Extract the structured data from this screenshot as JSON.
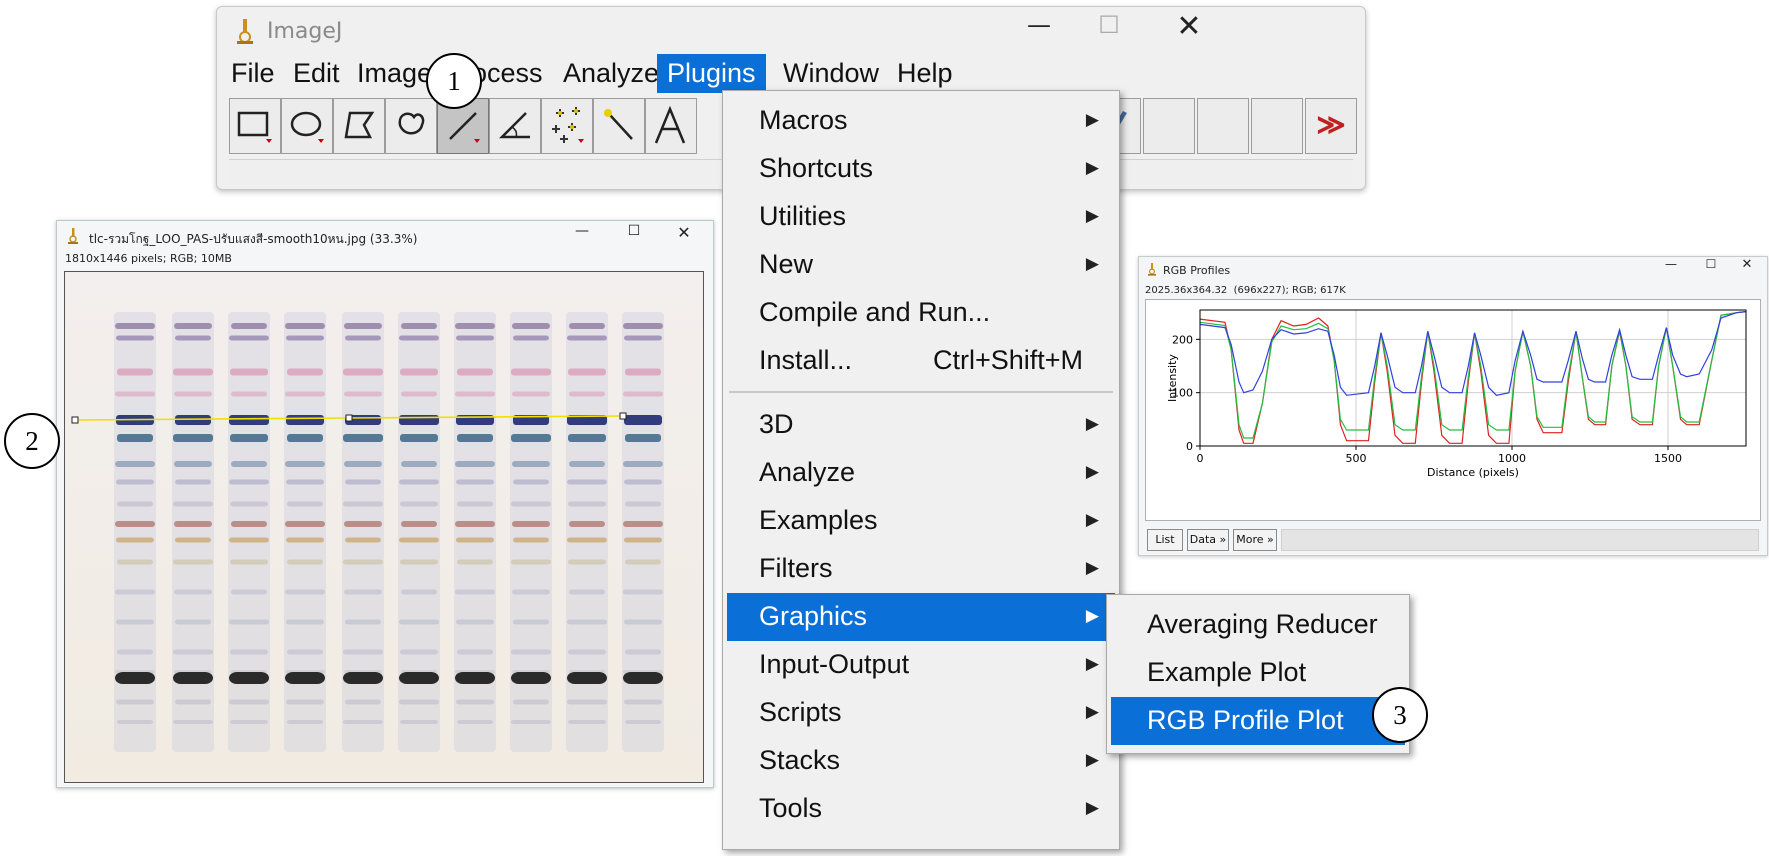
{
  "imagej": {
    "title": "ImageJ",
    "menus": [
      "File",
      "Edit",
      "Image",
      "Process",
      "Analyze",
      "Plugins",
      "Window",
      "Help"
    ],
    "more_tools": "≫"
  },
  "tlc_window": {
    "title": "tlc-รวมโกฐ_LOO_PAS-ปรับแสงสี-smooth10หน.jpg (33.3%)",
    "info": "1810x1446 pixels; RGB; 10MB"
  },
  "rgb_window": {
    "title": "RGB Profiles",
    "info": "2025.36x364.32  (696x227); RGB; 617K",
    "buttons": [
      "List",
      "Data »",
      "More »"
    ]
  },
  "plugins_menu": {
    "items": [
      {
        "label": "Macros",
        "sub": true
      },
      {
        "label": "Shortcuts",
        "sub": true
      },
      {
        "label": "Utilities",
        "sub": true
      },
      {
        "label": "New",
        "sub": true
      },
      {
        "label": "Compile and Run...",
        "sub": false
      },
      {
        "label": "Install...",
        "shortcut": "Ctrl+Shift+M",
        "sub": false
      },
      {
        "label": "3D",
        "sub": true
      },
      {
        "label": "Analyze",
        "sub": true
      },
      {
        "label": "Examples",
        "sub": true
      },
      {
        "label": "Filters",
        "sub": true
      },
      {
        "label": "Graphics",
        "sub": true,
        "highlighted": true
      },
      {
        "label": "Input-Output",
        "sub": true
      },
      {
        "label": "Scripts",
        "sub": true
      },
      {
        "label": "Stacks",
        "sub": true
      },
      {
        "label": "Tools",
        "sub": true
      }
    ]
  },
  "graphics_menu": {
    "items": [
      {
        "label": "Averaging Reducer"
      },
      {
        "label": "Example Plot"
      },
      {
        "label": "RGB Profile Plot",
        "highlighted": true
      }
    ]
  },
  "callouts": [
    "1",
    "2",
    "3"
  ],
  "chart_data": {
    "type": "line",
    "xlabel": "Distance (pixels)",
    "ylabel": "Intensity",
    "xlim": [
      0,
      1750
    ],
    "ylim": [
      0,
      255
    ],
    "xticks": [
      0,
      500,
      1000,
      1500
    ],
    "yticks": [
      0,
      100,
      200
    ],
    "series": [
      {
        "color": "#e02020",
        "points": [
          [
            0,
            238
          ],
          [
            80,
            232
          ],
          [
            100,
            180
          ],
          [
            125,
            30
          ],
          [
            140,
            5
          ],
          [
            170,
            5
          ],
          [
            200,
            80
          ],
          [
            230,
            200
          ],
          [
            260,
            235
          ],
          [
            300,
            225
          ],
          [
            340,
            228
          ],
          [
            380,
            240
          ],
          [
            410,
            225
          ],
          [
            430,
            160
          ],
          [
            450,
            40
          ],
          [
            470,
            10
          ],
          [
            540,
            10
          ],
          [
            560,
            120
          ],
          [
            580,
            212
          ],
          [
            600,
            140
          ],
          [
            625,
            20
          ],
          [
            650,
            5
          ],
          [
            690,
            5
          ],
          [
            710,
            120
          ],
          [
            730,
            215
          ],
          [
            750,
            140
          ],
          [
            775,
            20
          ],
          [
            800,
            5
          ],
          [
            840,
            5
          ],
          [
            860,
            120
          ],
          [
            880,
            212
          ],
          [
            900,
            140
          ],
          [
            925,
            20
          ],
          [
            950,
            5
          ],
          [
            990,
            5
          ],
          [
            1010,
            140
          ],
          [
            1035,
            215
          ],
          [
            1060,
            150
          ],
          [
            1080,
            50
          ],
          [
            1100,
            25
          ],
          [
            1160,
            25
          ],
          [
            1180,
            120
          ],
          [
            1205,
            215
          ],
          [
            1225,
            130
          ],
          [
            1245,
            50
          ],
          [
            1265,
            40
          ],
          [
            1300,
            40
          ],
          [
            1320,
            150
          ],
          [
            1345,
            215
          ],
          [
            1365,
            150
          ],
          [
            1385,
            50
          ],
          [
            1410,
            40
          ],
          [
            1450,
            40
          ],
          [
            1470,
            150
          ],
          [
            1495,
            222
          ],
          [
            1515,
            150
          ],
          [
            1540,
            50
          ],
          [
            1560,
            40
          ],
          [
            1600,
            40
          ],
          [
            1640,
            160
          ],
          [
            1670,
            245
          ],
          [
            1720,
            250
          ],
          [
            1750,
            252
          ]
        ]
      },
      {
        "color": "#20c040",
        "points": [
          [
            0,
            232
          ],
          [
            80,
            226
          ],
          [
            100,
            180
          ],
          [
            125,
            40
          ],
          [
            140,
            15
          ],
          [
            170,
            15
          ],
          [
            200,
            80
          ],
          [
            230,
            195
          ],
          [
            260,
            225
          ],
          [
            300,
            218
          ],
          [
            340,
            220
          ],
          [
            380,
            230
          ],
          [
            410,
            220
          ],
          [
            430,
            160
          ],
          [
            450,
            50
          ],
          [
            470,
            30
          ],
          [
            540,
            30
          ],
          [
            560,
            130
          ],
          [
            580,
            212
          ],
          [
            600,
            150
          ],
          [
            625,
            40
          ],
          [
            650,
            30
          ],
          [
            690,
            30
          ],
          [
            710,
            130
          ],
          [
            730,
            215
          ],
          [
            750,
            150
          ],
          [
            775,
            40
          ],
          [
            800,
            30
          ],
          [
            840,
            30
          ],
          [
            860,
            130
          ],
          [
            880,
            212
          ],
          [
            900,
            150
          ],
          [
            925,
            40
          ],
          [
            950,
            30
          ],
          [
            990,
            30
          ],
          [
            1010,
            140
          ],
          [
            1035,
            215
          ],
          [
            1060,
            150
          ],
          [
            1080,
            55
          ],
          [
            1100,
            35
          ],
          [
            1160,
            35
          ],
          [
            1180,
            130
          ],
          [
            1205,
            215
          ],
          [
            1225,
            130
          ],
          [
            1245,
            55
          ],
          [
            1265,
            45
          ],
          [
            1300,
            45
          ],
          [
            1320,
            150
          ],
          [
            1345,
            218
          ],
          [
            1365,
            150
          ],
          [
            1385,
            55
          ],
          [
            1410,
            45
          ],
          [
            1450,
            45
          ],
          [
            1470,
            150
          ],
          [
            1495,
            222
          ],
          [
            1515,
            150
          ],
          [
            1540,
            55
          ],
          [
            1560,
            45
          ],
          [
            1600,
            45
          ],
          [
            1640,
            160
          ],
          [
            1670,
            245
          ],
          [
            1720,
            250
          ],
          [
            1750,
            252
          ]
        ]
      },
      {
        "color": "#3040e0",
        "points": [
          [
            0,
            228
          ],
          [
            80,
            222
          ],
          [
            100,
            190
          ],
          [
            125,
            120
          ],
          [
            140,
            100
          ],
          [
            170,
            105
          ],
          [
            200,
            140
          ],
          [
            230,
            200
          ],
          [
            260,
            218
          ],
          [
            300,
            210
          ],
          [
            340,
            212
          ],
          [
            380,
            220
          ],
          [
            410,
            215
          ],
          [
            430,
            170
          ],
          [
            450,
            110
          ],
          [
            470,
            95
          ],
          [
            540,
            100
          ],
          [
            560,
            150
          ],
          [
            580,
            212
          ],
          [
            600,
            170
          ],
          [
            625,
            110
          ],
          [
            650,
            100
          ],
          [
            690,
            100
          ],
          [
            710,
            150
          ],
          [
            730,
            215
          ],
          [
            750,
            170
          ],
          [
            775,
            110
          ],
          [
            800,
            100
          ],
          [
            840,
            100
          ],
          [
            860,
            150
          ],
          [
            880,
            212
          ],
          [
            900,
            170
          ],
          [
            925,
            110
          ],
          [
            950,
            95
          ],
          [
            990,
            100
          ],
          [
            1010,
            160
          ],
          [
            1035,
            215
          ],
          [
            1060,
            170
          ],
          [
            1080,
            125
          ],
          [
            1100,
            120
          ],
          [
            1160,
            120
          ],
          [
            1180,
            160
          ],
          [
            1205,
            215
          ],
          [
            1225,
            165
          ],
          [
            1245,
            125
          ],
          [
            1265,
            120
          ],
          [
            1300,
            120
          ],
          [
            1320,
            170
          ],
          [
            1345,
            218
          ],
          [
            1365,
            170
          ],
          [
            1385,
            130
          ],
          [
            1410,
            125
          ],
          [
            1450,
            125
          ],
          [
            1470,
            170
          ],
          [
            1495,
            222
          ],
          [
            1515,
            170
          ],
          [
            1540,
            135
          ],
          [
            1560,
            130
          ],
          [
            1600,
            135
          ],
          [
            1640,
            180
          ],
          [
            1670,
            240
          ],
          [
            1720,
            250
          ],
          [
            1750,
            252
          ]
        ]
      }
    ]
  }
}
